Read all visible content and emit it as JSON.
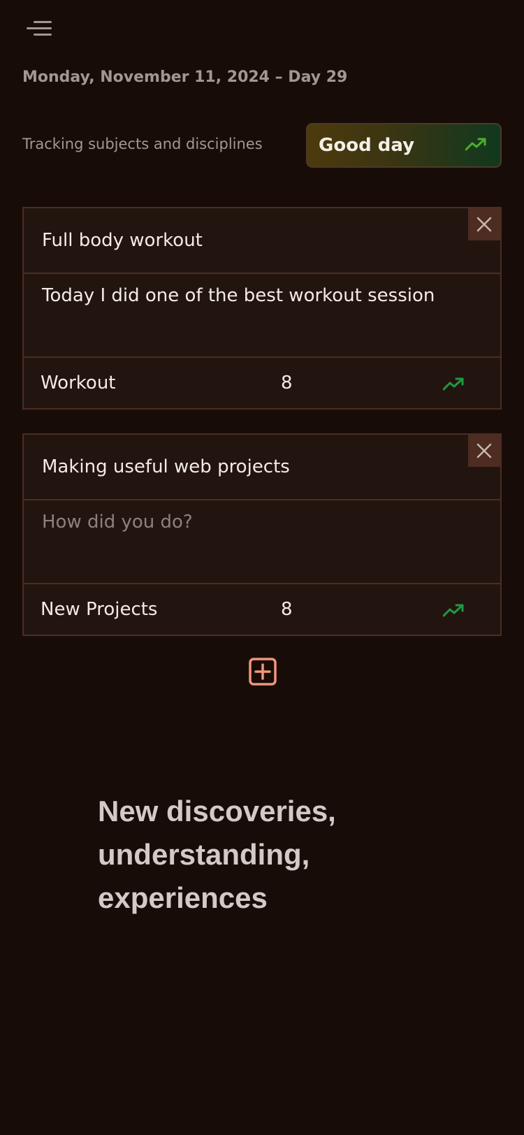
{
  "header": {
    "date_line": "Monday, November 11, 2024 – Day 29",
    "subtitle": "Tracking subjects and disciplines",
    "day_status": {
      "label": "Good day",
      "icon": "trending-up-icon",
      "accent": "#4cae2f"
    }
  },
  "entries": [
    {
      "title": "Full body workout",
      "note": "Today I did one of the best workout session",
      "subject": "Workout",
      "score": "8",
      "trend_icon": "trending-up-icon"
    },
    {
      "title": "Making useful web projects",
      "note_placeholder": "How did you do?",
      "subject": "New Projects",
      "score": "8",
      "trend_icon": "trending-up-icon"
    }
  ],
  "quote": {
    "lines": [
      "New discoveries,",
      "understanding,",
      "experiences"
    ]
  },
  "colors": {
    "background": "#180c09",
    "card": "#221510",
    "card_border": "#4b2d22",
    "trend_up": "#1f9a43",
    "add_button": "#f0967a"
  }
}
